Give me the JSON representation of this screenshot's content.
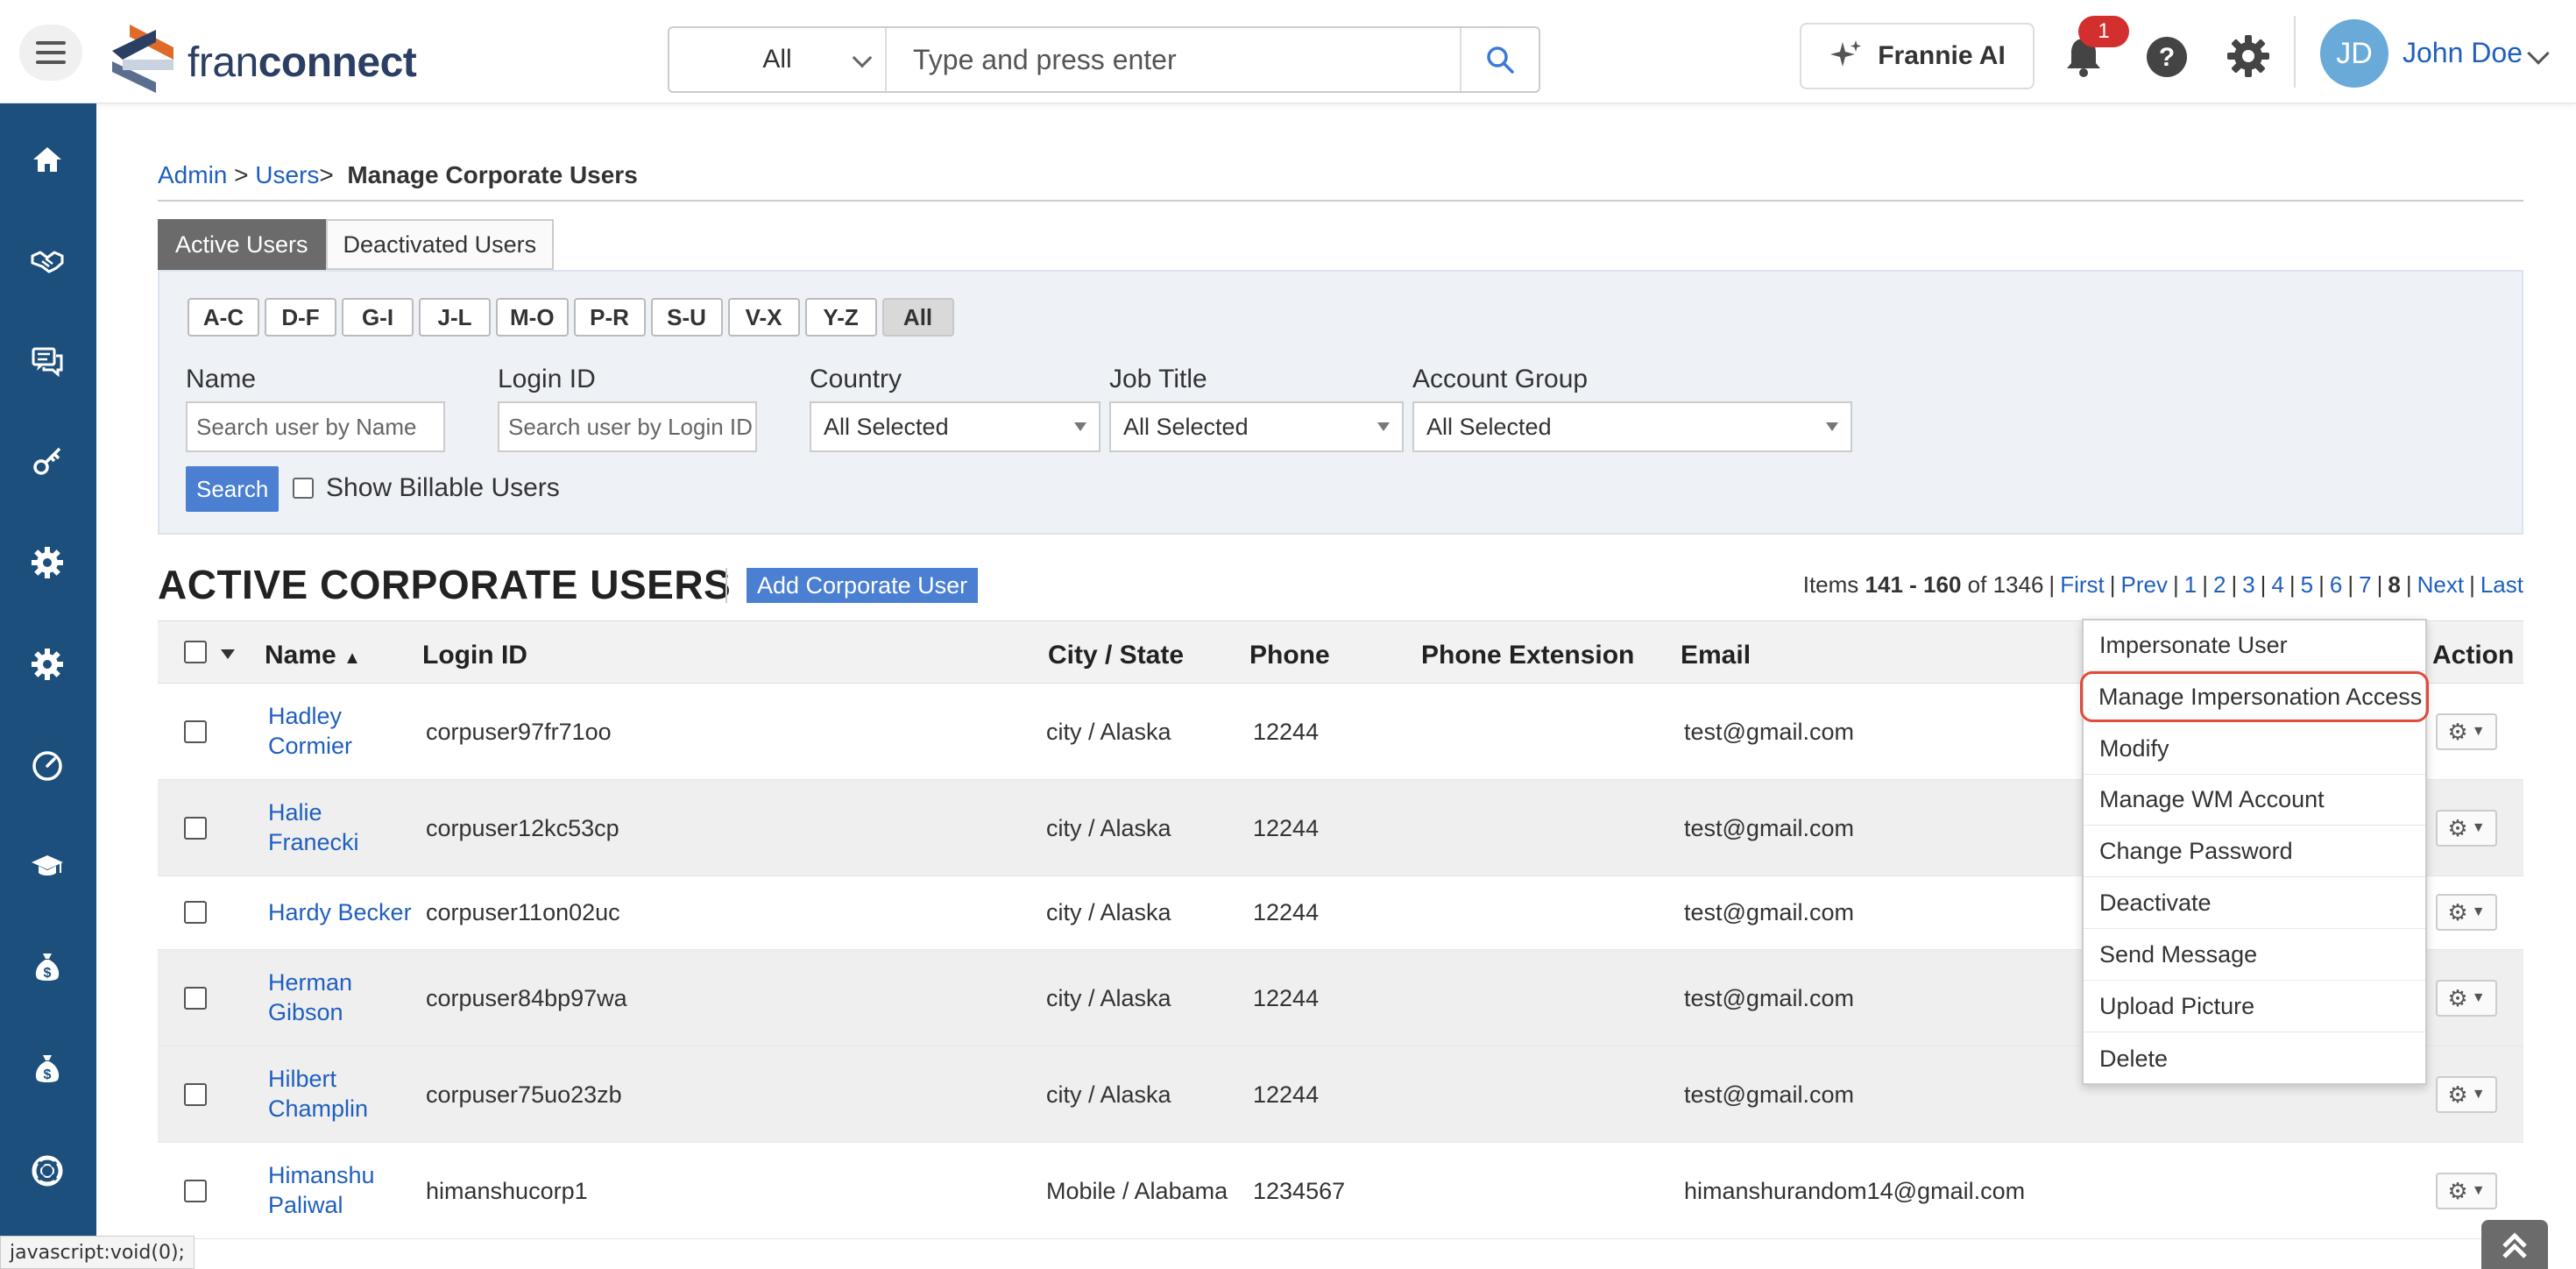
{
  "header": {
    "logo_text_prefix": "fran",
    "logo_text_suffix": "connect",
    "search_scope": "All",
    "search_placeholder": "Type and press enter",
    "frannie_label": "Frannie AI",
    "notification_count": "1",
    "user_initials": "JD",
    "user_name": "John Doe"
  },
  "sidebar": {
    "icons": [
      "home-icon",
      "handshake-icon",
      "chat-icon",
      "key-icon",
      "gear-icon",
      "gear-icon",
      "dashboard-icon",
      "graduation-cap-icon",
      "money-bag-icon",
      "money-bag-icon",
      "lifebuoy-icon"
    ],
    "bg_color": "#1c4f7c"
  },
  "breadcrumb": {
    "admin": "Admin",
    "sep1": ">",
    "users": "Users",
    "sep2": ">",
    "current": "Manage Corporate Users"
  },
  "tabs": [
    {
      "label": "Active Users",
      "active": true
    },
    {
      "label": "Deactivated Users",
      "active": false
    }
  ],
  "filters": {
    "letters": [
      "A-C",
      "D-F",
      "G-I",
      "J-L",
      "M-O",
      "P-R",
      "S-U",
      "V-X",
      "Y-Z",
      "All"
    ],
    "name_label": "Name",
    "name_placeholder": "Search user by Name",
    "login_label": "Login ID",
    "login_placeholder": "Search user by Login ID",
    "country_label": "Country",
    "country_value": "All Selected",
    "job_label": "Job Title",
    "job_value": "All Selected",
    "group_label": "Account Group",
    "group_value": "All Selected",
    "search_button": "Search",
    "billable_label": "Show Billable Users"
  },
  "section": {
    "title": "ACTIVE CORPORATE USERS",
    "add_button": "Add Corporate User"
  },
  "pagination": {
    "items_label": "Items",
    "range": "141 - 160",
    "of_label": "of",
    "total": "1346",
    "first": "First",
    "prev": "Prev",
    "pages": [
      "1",
      "2",
      "3",
      "4",
      "5",
      "6",
      "7"
    ],
    "current_page": "8",
    "next": "Next",
    "last": "Last"
  },
  "table": {
    "headers": {
      "name": "Name",
      "login": "Login ID",
      "city_state": "City /  State",
      "phone": "Phone",
      "extension": "Phone Extension",
      "email": "Email",
      "action": "Action"
    },
    "rows": [
      {
        "name_line1": "Hadley",
        "name_line2": "Cormier",
        "login": "corpuser97fr71oo",
        "city": "city / Alaska",
        "phone": "12244",
        "email": "test@gmail.com"
      },
      {
        "name_line1": "Halie",
        "name_line2": "Franecki",
        "login": "corpuser12kc53cp",
        "city": "city / Alaska",
        "phone": "12244",
        "email": "test@gmail.com"
      },
      {
        "name_line1": "Hardy Becker",
        "name_line2": "",
        "login": "corpuser11on02uc",
        "city": "city / Alaska",
        "phone": "12244",
        "email": "test@gmail.com"
      },
      {
        "name_line1": "Herman",
        "name_line2": "Gibson",
        "login": "corpuser84bp97wa",
        "city": "city / Alaska",
        "phone": "12244",
        "email": "test@gmail.com"
      },
      {
        "name_line1": "Hilbert",
        "name_line2": "Champlin",
        "login": "corpuser75uo23zb",
        "city": "city / Alaska",
        "phone": "12244",
        "email": "test@gmail.com"
      },
      {
        "name_line1": "Himanshu",
        "name_line2": "Paliwal",
        "login": "himanshucorp1",
        "city": "Mobile / Alabama",
        "phone": "1234567",
        "email": "himanshurandom14@gmail.com"
      }
    ]
  },
  "action_menu": {
    "items": [
      "Impersonate User",
      "Manage Impersonation Access",
      "Modify",
      "Manage WM Account",
      "Change Password",
      "Deactivate",
      "Send Message",
      "Upload Picture",
      "Delete"
    ],
    "highlighted": "Manage Impersonation Access",
    "highlight_color": "#e14b3b"
  },
  "statusbar": {
    "text": "javascript:void(0);"
  }
}
